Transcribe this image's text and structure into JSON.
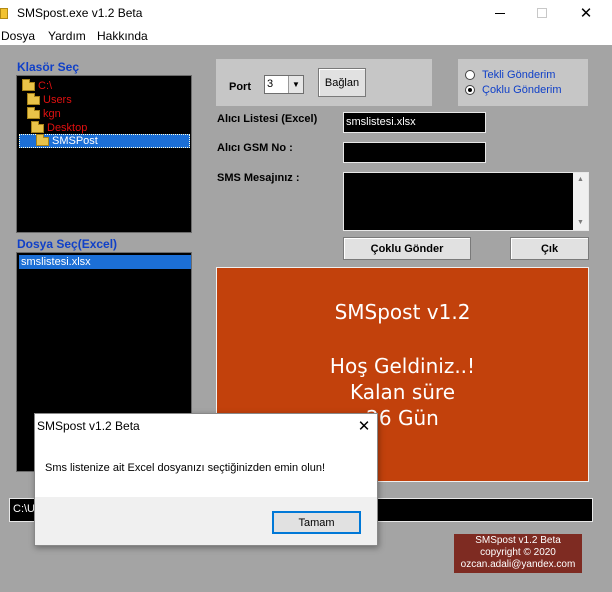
{
  "window": {
    "title": "SMSpost.exe  v1.2 Beta",
    "minimize_glyph": "—",
    "maximize_glyph": "□",
    "close_glyph": "✕"
  },
  "menu": [
    "Dosya",
    "Yardım",
    "Hakkında"
  ],
  "folder_panel": {
    "label": "Klasör Seç",
    "items": [
      {
        "label": "C:\\",
        "icon": "folder-icon"
      },
      {
        "label": "Users",
        "icon": "folder-icon"
      },
      {
        "label": "kgn",
        "icon": "folder-icon"
      },
      {
        "label": "Desktop",
        "icon": "folder-icon"
      },
      {
        "label": "SMSPost",
        "icon": "folder-icon",
        "selected": true
      }
    ]
  },
  "file_panel": {
    "label": "Dosya Seç(Excel)",
    "items": [
      "smslistesi.xlsx"
    ]
  },
  "port": {
    "label": "Port",
    "value": "3",
    "arrow_glyph": "▼",
    "connect_label": "Bağlan"
  },
  "mode": {
    "options": [
      {
        "label": "Tekli Gönderim",
        "checked": false
      },
      {
        "label": "Çoklu Gönderim",
        "checked": true
      }
    ]
  },
  "form": {
    "recipient_list_label": "Alıcı Listesi (Excel)",
    "recipient_list_value": "smslistesi.xlsx",
    "gsm_label": "Alıcı GSM No    :",
    "gsm_value": "",
    "message_label": "SMS Mesajınız   :",
    "message_value": "",
    "scroll_up_glyph": "▲",
    "scroll_down_glyph": "▼"
  },
  "buttons": {
    "send_label": "Çoklu Gönder",
    "exit_label": "Çık"
  },
  "welcome": {
    "line1": "SMSpost v1.2",
    "line2": "Hoş Geldiniz..!",
    "line3": "Kalan süre",
    "line4": "26 Gün"
  },
  "path_bar": {
    "value": "C:\\Users\\kgn\\Desktop\\SMSPost\\smslistesi.xlsx"
  },
  "credit": {
    "line1": "SMSpost v1.2 Beta",
    "line2": "copyright © 2020",
    "line3": "ozcan.adali@yandex.com"
  },
  "dialog": {
    "title": "SMSpost v1.2 Beta",
    "close_glyph": "✕",
    "message": "Sms listenize ait Excel dosyanızı seçtiğinizden emin olun!",
    "ok_label": "Tamam"
  },
  "colors": {
    "client_bg": "#a4a4a4",
    "label_blue": "#1040c8",
    "tree_red": "#e01010",
    "selection_blue": "#1c6fd6",
    "welcome_orange": "#c2410c",
    "credit_maroon": "#7e2b22"
  }
}
